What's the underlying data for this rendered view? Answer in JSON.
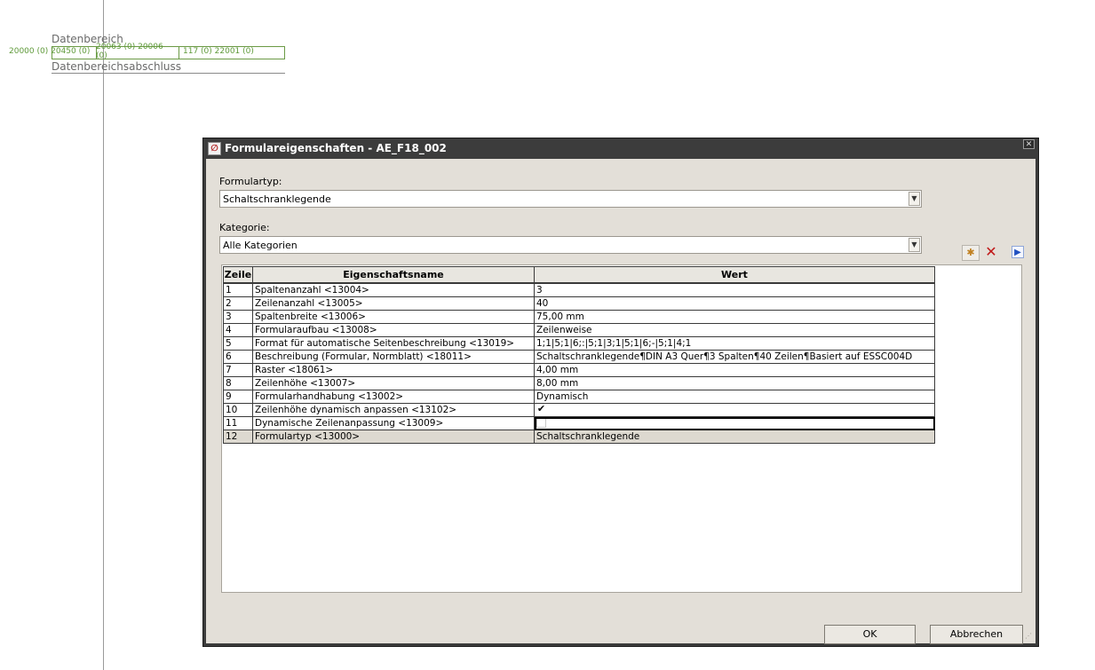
{
  "background": {
    "label_top": "Datenbereich",
    "label_bottom": "Datenbereichsabschluss",
    "cells": [
      "20000 (0) 20450 (0)",
      "20063 (0) 20006 (0)",
      "117 (0) 22001 (0)"
    ]
  },
  "dialog": {
    "title": "Formulareigenschaften - AE_F18_002",
    "close_icon": "close-icon",
    "formtype_label": "Formulartyp:",
    "formtype_value": "Schaltschranklegende",
    "category_label": "Kategorie:",
    "category_value": "Alle Kategorien",
    "toolbar": {
      "new_icon": "new-property-icon",
      "delete_icon": "delete-icon",
      "expand_icon": "expand-icon"
    },
    "table": {
      "headers": [
        "Zeile",
        "Eigenschaftsname",
        "Wert"
      ],
      "rows": [
        {
          "row": "1",
          "name": "Spaltenanzahl <13004>",
          "value": "3"
        },
        {
          "row": "2",
          "name": "Zeilenanzahl <13005>",
          "value": "40"
        },
        {
          "row": "3",
          "name": "Spaltenbreite <13006>",
          "value": "75,00 mm"
        },
        {
          "row": "4",
          "name": "Formularaufbau <13008>",
          "value": "Zeilenweise"
        },
        {
          "row": "5",
          "name": "Format für automatische Seitenbeschreibung <13019>",
          "value": "1;1|5;1|6;:|5;1|3;1|5;1|6;-|5;1|4;1"
        },
        {
          "row": "6",
          "name": "Beschreibung (Formular, Normblatt) <18011>",
          "value": "Schaltschranklegende¶DIN A3 Quer¶3 Spalten¶40 Zeilen¶Basiert auf ESSC004D"
        },
        {
          "row": "7",
          "name": "Raster <18061>",
          "value": "4,00 mm"
        },
        {
          "row": "8",
          "name": "Zeilenhöhe <13007>",
          "value": "8,00 mm"
        },
        {
          "row": "9",
          "name": "Formularhandhabung <13002>",
          "value": "Dynamisch"
        },
        {
          "row": "10",
          "name": "Zeilenhöhe dynamisch anpassen <13102>",
          "value": "",
          "checkbox": true
        },
        {
          "row": "11",
          "name": "Dynamische Zeilenanpassung <13009>",
          "value": "",
          "checkbox": false
        },
        {
          "row": "12",
          "name": "Formulartyp <13000>",
          "value": "Schaltschranklegende"
        }
      ]
    },
    "ok_label": "OK",
    "cancel_label": "Abbrechen"
  },
  "colors": {
    "titlebar": "#3c3c3c",
    "dialog_bg": "#e3dfd8",
    "readonly_row": "#ddd9d0",
    "bg_green": "#5f9a3a"
  }
}
